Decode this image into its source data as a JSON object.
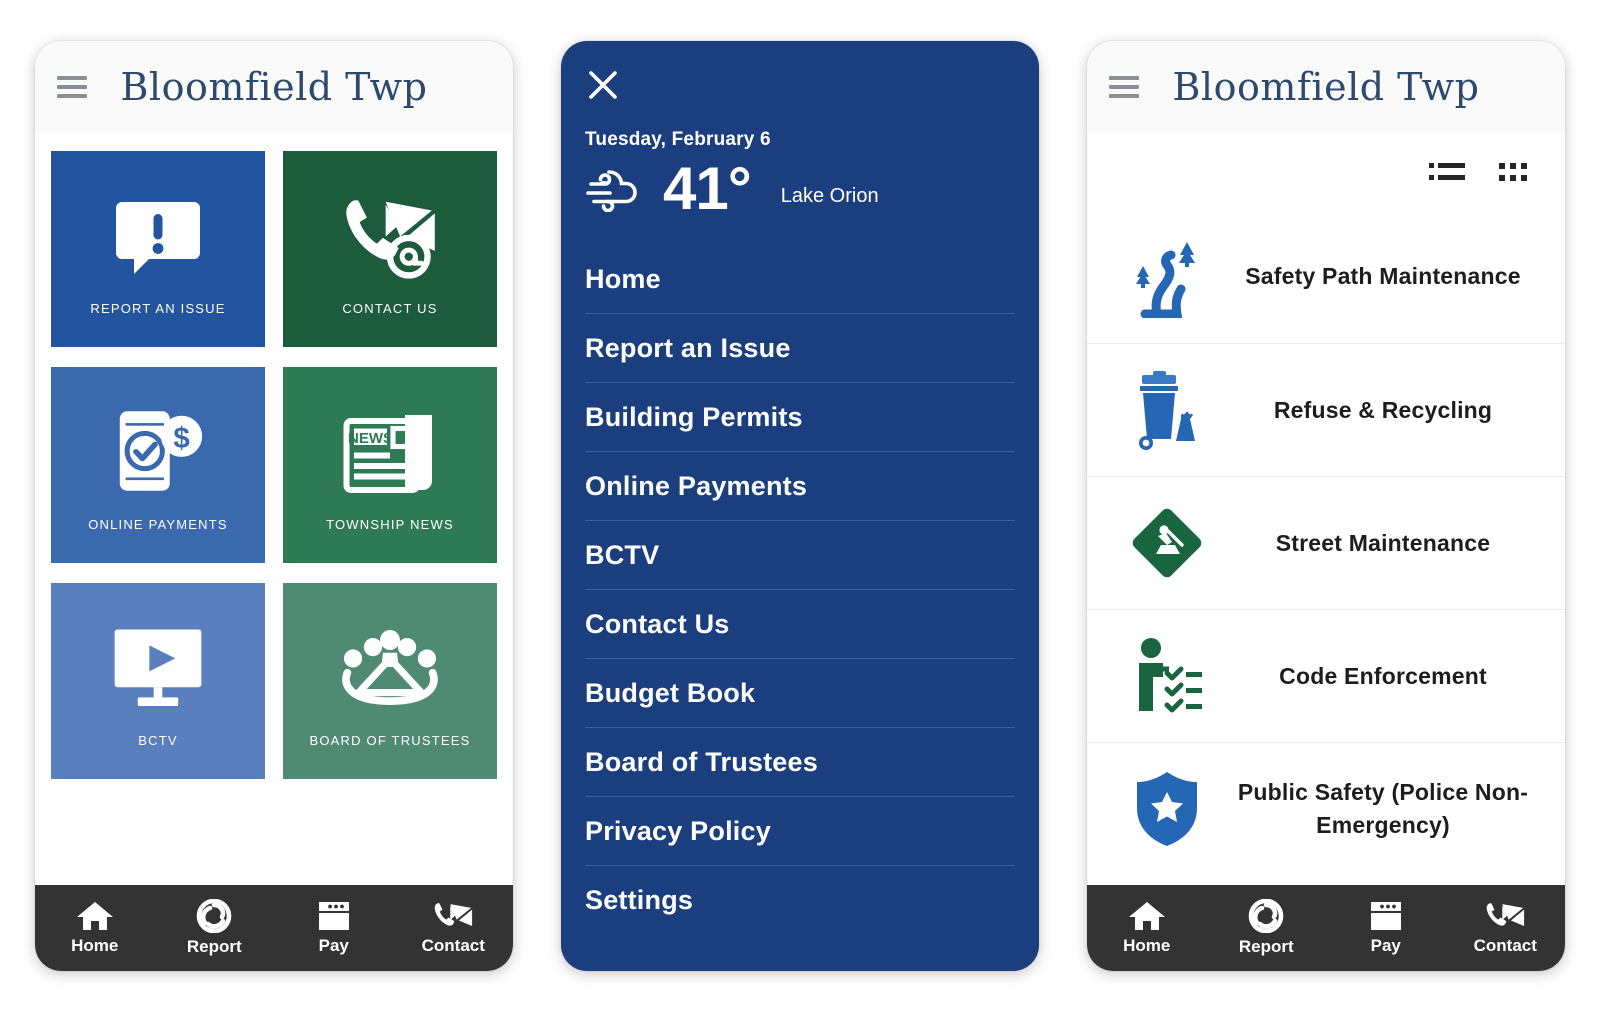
{
  "colors": {
    "tile_blue_dark": "#22549F",
    "tile_green_dark": "#1C5B3B",
    "tile_blue_mid": "#3A69AE",
    "tile_green_mid": "#2D7A55",
    "tile_blue_light": "#5A7FBF",
    "tile_green_light": "#4F8A72",
    "menu_navy": "#1B3F7E",
    "nav_bar": "#333333",
    "appbar_bg": "#FAFAFA",
    "title_text": "#2C4A6E",
    "icon_blue": "#2566B5",
    "icon_green": "#196B48"
  },
  "home_screen": {
    "menu_icon": "hamburger-icon",
    "title": "Bloomfield Twp",
    "tiles": [
      {
        "label": "REPORT AN ISSUE",
        "icon": "alert-speech-bubble-icon",
        "color_key": "tile_blue_dark"
      },
      {
        "label": "CONTACT US",
        "icon": "phone-envelope-at-icon",
        "color_key": "tile_green_dark"
      },
      {
        "label": "ONLINE PAYMENTS",
        "icon": "phone-dollar-check-icon",
        "color_key": "tile_blue_mid"
      },
      {
        "label": "TOWNSHIP NEWS",
        "icon": "newspaper-icon",
        "color_key": "tile_green_mid"
      },
      {
        "label": "BCTV",
        "icon": "monitor-play-icon",
        "color_key": "tile_blue_light"
      },
      {
        "label": "BOARD OF TRUSTEES",
        "icon": "group-people-icon",
        "color_key": "tile_green_light"
      }
    ]
  },
  "menu_screen": {
    "close_icon": "close-x-icon",
    "weather": {
      "date": "Tuesday, February 6",
      "icon": "wind-cloud-icon",
      "temperature": "41°",
      "city": "Lake Orion"
    },
    "items": [
      "Home",
      "Report an Issue",
      "Building Permits",
      "Online Payments",
      "BCTV",
      "Contact Us",
      "Budget Book",
      "Board of Trustees",
      "Privacy Policy",
      "Settings"
    ]
  },
  "services_screen": {
    "menu_icon": "hamburger-icon",
    "title": "Bloomfield Twp",
    "view_toggles": [
      {
        "icon": "list-view-icon",
        "name": "list-view-toggle"
      },
      {
        "icon": "grid-view-icon",
        "name": "grid-view-toggle"
      }
    ],
    "items": [
      {
        "label": "Safety Path Maintenance",
        "icon": "winding-path-trees-icon",
        "color_key": "icon_blue"
      },
      {
        "label": "Refuse & Recycling",
        "icon": "trash-bin-bag-icon",
        "color_key": "icon_blue"
      },
      {
        "label": "Street Maintenance",
        "icon": "road-work-sign-icon",
        "color_key": "icon_green"
      },
      {
        "label": "Code Enforcement",
        "icon": "person-checklist-icon",
        "color_key": "icon_green"
      },
      {
        "label": "Public Safety (Police Non-Emergency)",
        "icon": "shield-star-icon",
        "color_key": "icon_blue"
      }
    ]
  },
  "bottom_nav": [
    {
      "label": "Home",
      "icon": "house-icon"
    },
    {
      "label": "Report",
      "icon": "camera-shutter-icon"
    },
    {
      "label": "Pay",
      "icon": "browser-window-icon"
    },
    {
      "label": "Contact",
      "icon": "phone-envelope-icon"
    }
  ]
}
